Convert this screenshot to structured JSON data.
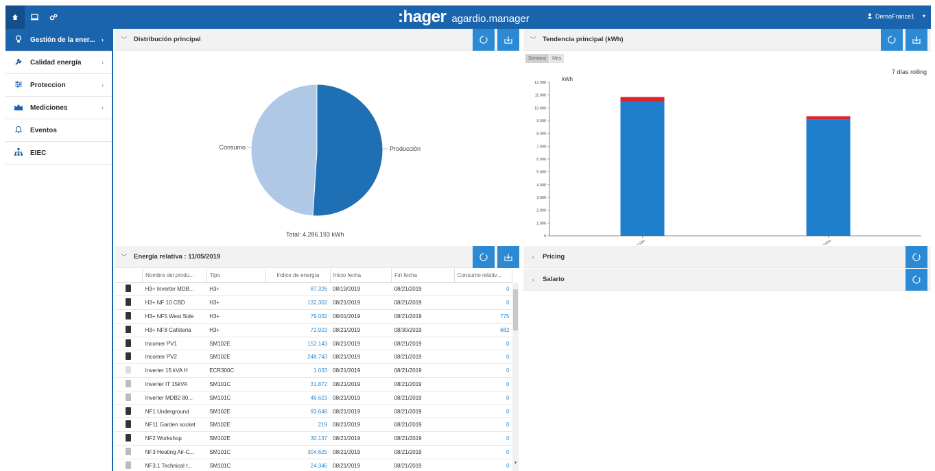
{
  "topbar": {
    "brand_logo": ":hager",
    "brand_name": "agardio.manager",
    "user": "DemoFrance1",
    "icons": [
      "home-icon",
      "monitor-icon",
      "gears-icon"
    ]
  },
  "sidebar": {
    "items": [
      {
        "label": "Gestión de la ener...",
        "icon": "bulb-icon"
      },
      {
        "label": "Calidad energía",
        "icon": "plug-icon"
      },
      {
        "label": "Proteccion",
        "icon": "sliders-icon"
      },
      {
        "label": "Mediciones",
        "icon": "chart-icon"
      },
      {
        "label": "Eventos",
        "icon": "bell-icon"
      },
      {
        "label": "EIEC",
        "icon": "network-icon"
      }
    ]
  },
  "distribucion": {
    "title": "Distribución principal",
    "total": "Total: 4.286.193 kWh",
    "label_consumo": "Consumo",
    "label_produccion": "Producción"
  },
  "tendencia": {
    "title": "Tendencia principal (kWh)",
    "tabs": [
      "Semana",
      "Mes"
    ],
    "rolling": "7 días rolling",
    "ylabel": "kWh"
  },
  "energia": {
    "title": "Energía relativa : 11/05/2019",
    "columns": [
      "Nombre del produ...",
      "Tipo",
      "Indice de energía",
      "Inicio fecha",
      "Fin fecha",
      "Consumo relativ..."
    ],
    "rows": [
      {
        "name": "H3+ Inverter MDB...",
        "tipo": "H3+",
        "indice": "87.326",
        "inicio": "08/19/2019",
        "fin": "08/21/2019",
        "consumo": "0"
      },
      {
        "name": "H3+ NF 10 CBD",
        "tipo": "H3+",
        "indice": "132.302",
        "inicio": "08/21/2019",
        "fin": "08/21/2019",
        "consumo": "0"
      },
      {
        "name": "H3+ NF5 West Side",
        "tipo": "H3+",
        "indice": "79.032",
        "inicio": "08/01/2019",
        "fin": "08/21/2019",
        "consumo": "775"
      },
      {
        "name": "H3+ NF8 Cafeteria",
        "tipo": "H3+",
        "indice": "72.923",
        "inicio": "08/21/2019",
        "fin": "08/30/2019",
        "consumo": "682"
      },
      {
        "name": "Incomer PV1",
        "tipo": "SM102E",
        "indice": "152.143",
        "inicio": "08/21/2019",
        "fin": "08/21/2019",
        "consumo": "0"
      },
      {
        "name": "Incomer PV2",
        "tipo": "SM102E",
        "indice": "248.743",
        "inicio": "08/21/2019",
        "fin": "08/21/2019",
        "consumo": "0"
      },
      {
        "name": "Inverter 15 kVA H",
        "tipo": "ECR300C",
        "indice": "1.033",
        "inicio": "08/21/2019",
        "fin": "08/21/2019",
        "consumo": "0"
      },
      {
        "name": "Inverter IT 15kVA",
        "tipo": "SM101C",
        "indice": "31.872",
        "inicio": "08/21/2019",
        "fin": "08/21/2019",
        "consumo": "0"
      },
      {
        "name": "Inverter MDB2 80...",
        "tipo": "SM101C",
        "indice": "46.623",
        "inicio": "08/21/2019",
        "fin": "08/21/2019",
        "consumo": "0"
      },
      {
        "name": "NF1 Underground",
        "tipo": "SM102E",
        "indice": "93.648",
        "inicio": "08/21/2019",
        "fin": "08/21/2019",
        "consumo": "0"
      },
      {
        "name": "NF11 Garden socket",
        "tipo": "SM102E",
        "indice": "219",
        "inicio": "08/21/2019",
        "fin": "08/21/2019",
        "consumo": "0"
      },
      {
        "name": "NF2 Workshop",
        "tipo": "SM102E",
        "indice": "30.137",
        "inicio": "08/21/2019",
        "fin": "08/21/2019",
        "consumo": "0"
      },
      {
        "name": "NF3 Heating Air-C...",
        "tipo": "SM101C",
        "indice": "304.625",
        "inicio": "08/21/2019",
        "fin": "08/21/2019",
        "consumo": "0"
      },
      {
        "name": "NF3.1 Technical r...",
        "tipo": "SM101C",
        "indice": "24.346",
        "inicio": "08/21/2019",
        "fin": "08/21/2019",
        "consumo": "0"
      }
    ]
  },
  "pricing": {
    "title": "Pricing"
  },
  "salario": {
    "title": "Salario"
  },
  "colors": {
    "brand": "#1a64ad",
    "button": "#2b8ad3",
    "pie_light": "#aec8e6",
    "bar_top": "#d9262f"
  },
  "chart_data": [
    {
      "type": "pie",
      "categories": [
        "Producción",
        "Consumo"
      ],
      "values": [
        51,
        49
      ],
      "colors": [
        "#1f6fb5",
        "#aec8e6"
      ]
    },
    {
      "type": "bar",
      "categories": [
        "Producción",
        "Consumo"
      ],
      "ylabel": "kWh",
      "ylim": [
        0,
        12000
      ],
      "yticks": [
        "0",
        "1.000",
        "2.000",
        "3.000",
        "4.000",
        "5.000",
        "6.000",
        "7.000",
        "8.000",
        "9.000",
        "10.000",
        "11.000",
        "12.000"
      ],
      "series": [
        {
          "values": [
            10500,
            9100
          ]
        },
        {
          "values": [
            350,
            250
          ]
        }
      ]
    }
  ]
}
